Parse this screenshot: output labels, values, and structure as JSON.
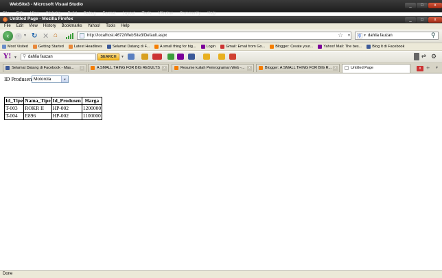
{
  "vs": {
    "title": "WebSite3 - Microsoft Visual Studio",
    "menu": [
      "File",
      "Edit",
      "View",
      "Website",
      "Build",
      "Debug",
      "Format",
      "Layout",
      "Tools",
      "Window",
      "Community",
      "Help"
    ]
  },
  "firefox": {
    "title": "Untitled Page - Mozilla Firefox",
    "min_label": "_",
    "max_label": "□",
    "close_label": "x"
  },
  "menubar": [
    "File",
    "Edit",
    "View",
    "History",
    "Bookmarks",
    "Yahoo!",
    "Tools",
    "Help"
  ],
  "nav": {
    "url": "http://localhost:4672/WebSite3/Default.aspx",
    "search_value": "dahlia fauzan"
  },
  "bookmarks": [
    {
      "label": "Most Visited",
      "color": "#6a8cc8"
    },
    {
      "label": "Getting Started",
      "color": "#e8883a"
    },
    {
      "label": "Latest Headlines",
      "color": "#e8883a"
    },
    {
      "label": "Selamat Datang di F...",
      "color": "#3b5998"
    },
    {
      "label": "A small thing for big...",
      "color": "#f57d00"
    },
    {
      "label": "Login",
      "color": "#7b0099"
    },
    {
      "label": "Gmail: Email from Go...",
      "color": "#c33"
    },
    {
      "label": "Blogger: Create your...",
      "color": "#f57d00"
    },
    {
      "label": "Yahoo! Mail: The bes...",
      "color": "#7b0099"
    },
    {
      "label": "Blog It di Facebook",
      "color": "#3b5998"
    }
  ],
  "yahoo": {
    "logo": "Y!",
    "search_value": "dahlia fauzan",
    "search_button": "SEARCH"
  },
  "tabs": [
    {
      "label": "Selamat Datang di Facebook - Mas...",
      "color": "#3b5998",
      "active": false
    },
    {
      "label": "A SMALL THING FOR BIG RESULTS",
      "color": "#f57d00",
      "active": false
    },
    {
      "label": "Resume kuliah Pemrograman Web -...",
      "color": "#f57d00",
      "active": false
    },
    {
      "label": "Blogger: A SMALL THING FOR BIG R...",
      "color": "#f57d00",
      "active": false
    },
    {
      "label": "Untitled Page",
      "color": "#ffffff",
      "active": true
    }
  ],
  "content": {
    "label": "ID Produsen",
    "selected": "Motorola",
    "table": {
      "headers": [
        "Id_Tipe",
        "Nama_Tipe",
        "Id_Produsen",
        "Harga"
      ],
      "rows": [
        [
          "T-003",
          "ROKR II",
          "HP-002",
          "1200000"
        ],
        [
          "T-004",
          "E896",
          "HP-002",
          "1100000"
        ]
      ]
    }
  },
  "status": "Done"
}
